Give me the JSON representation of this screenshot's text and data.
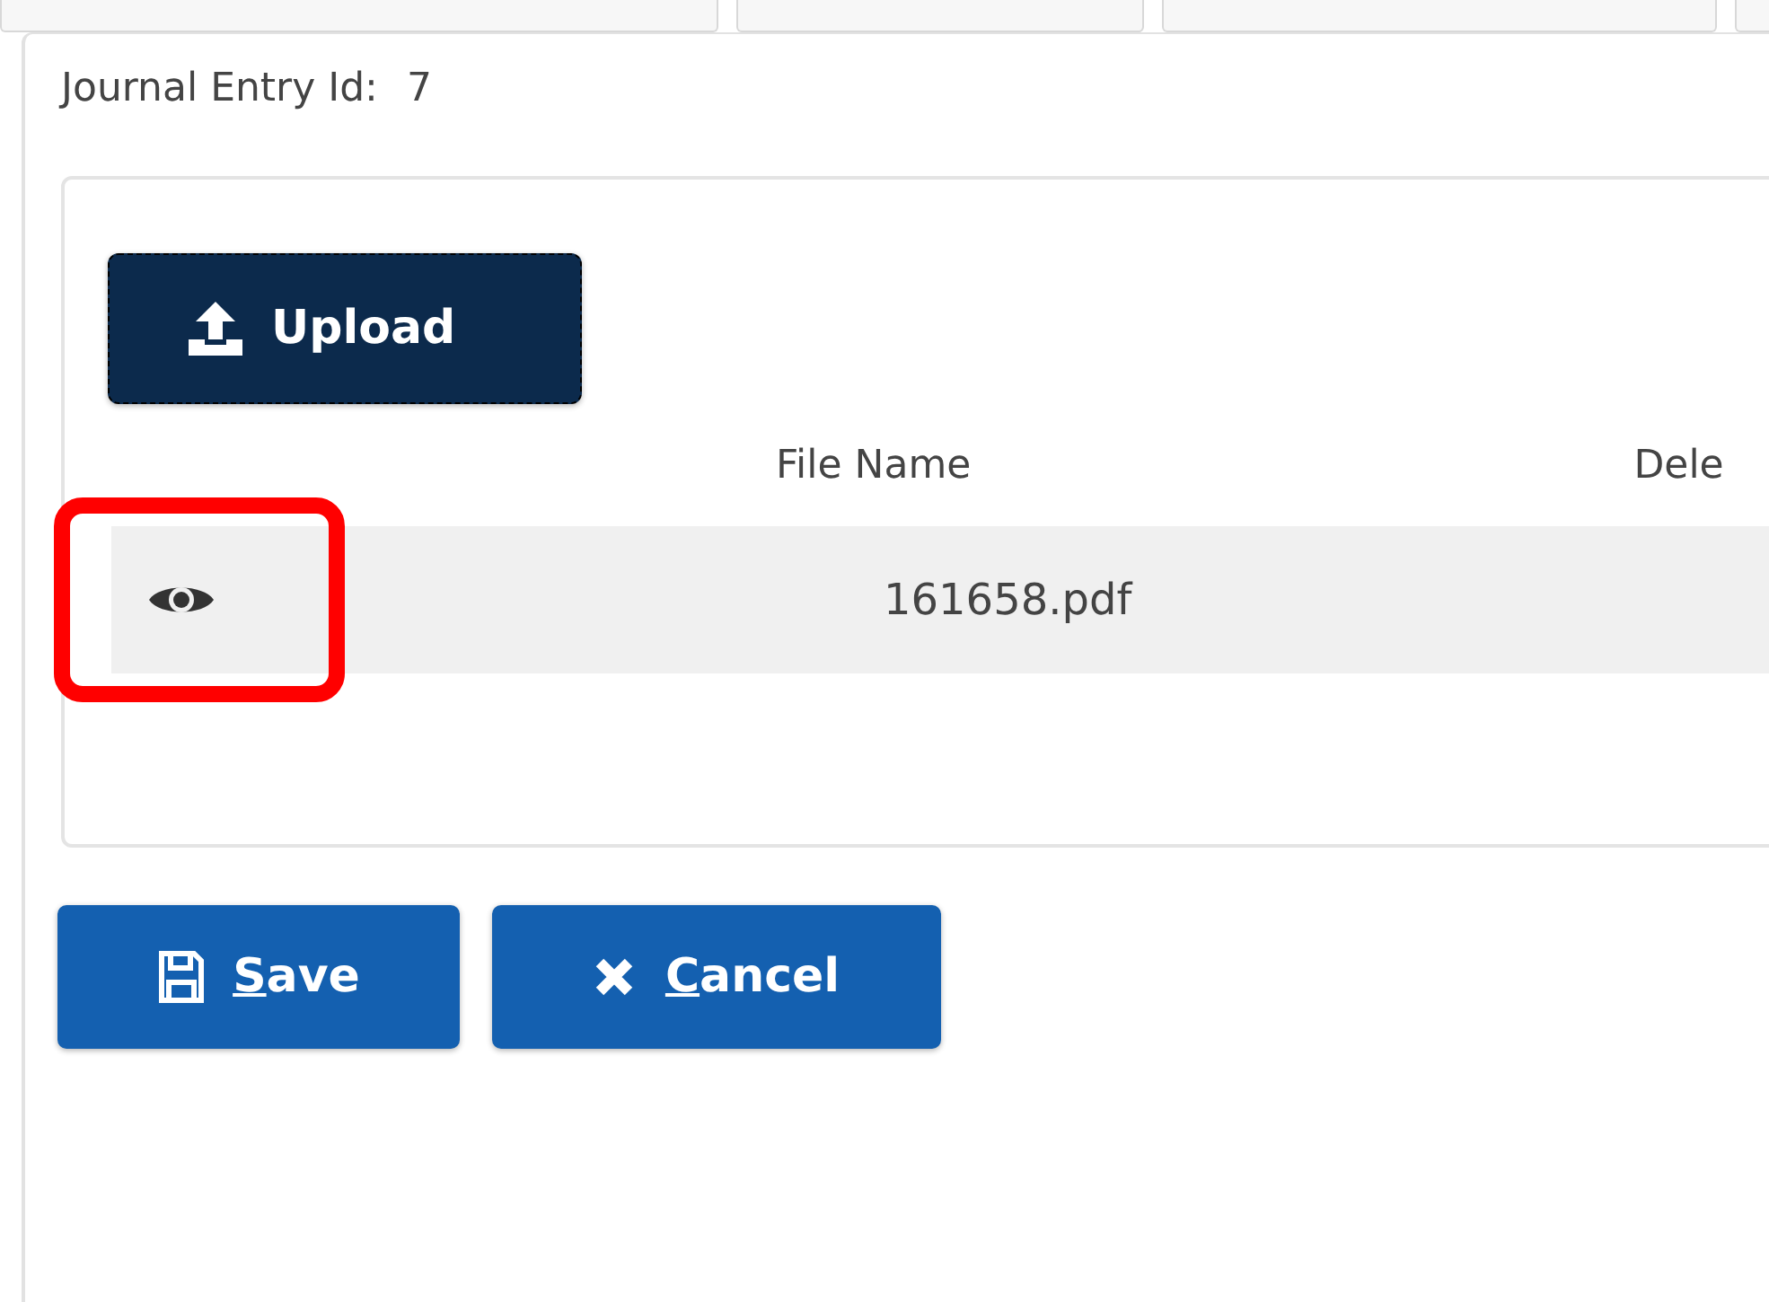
{
  "journal_entry": {
    "label": "Journal Entry Id:",
    "value": "7"
  },
  "upload_button": {
    "label": "Upload"
  },
  "attachments": {
    "columns": [
      "File Name",
      "Dele"
    ],
    "rows": [
      {
        "file_name": "161658.pdf",
        "highlighted": true
      }
    ]
  },
  "buttons": [
    {
      "kind": "save",
      "label": "Save",
      "access_key_underlined": true
    },
    {
      "kind": "cancel",
      "label": "Cancel",
      "access_key_underlined": true
    }
  ]
}
